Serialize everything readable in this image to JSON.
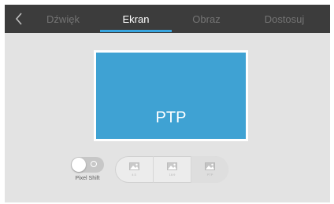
{
  "header": {
    "back_icon": "chevron-left-icon",
    "tabs": [
      {
        "label": "Dźwięk",
        "active": false
      },
      {
        "label": "Ekran",
        "active": true
      },
      {
        "label": "Obraz",
        "active": false
      },
      {
        "label": "Dostosuj",
        "active": false
      }
    ]
  },
  "preview": {
    "label": "PTP",
    "color": "#3fa2d3"
  },
  "pixel_shift": {
    "label": "Pixel Shift",
    "enabled": false
  },
  "aspect_modes": [
    {
      "label": "4:3",
      "icon": "picture-icon",
      "selected": false
    },
    {
      "label": "16:9",
      "icon": "picture-icon",
      "selected": false
    },
    {
      "label": "PTP",
      "icon": "picture-icon",
      "selected": true
    }
  ],
  "colors": {
    "topbar": "#3c3c3c",
    "accent": "#39a6e0",
    "background": "#e3e3e3"
  }
}
